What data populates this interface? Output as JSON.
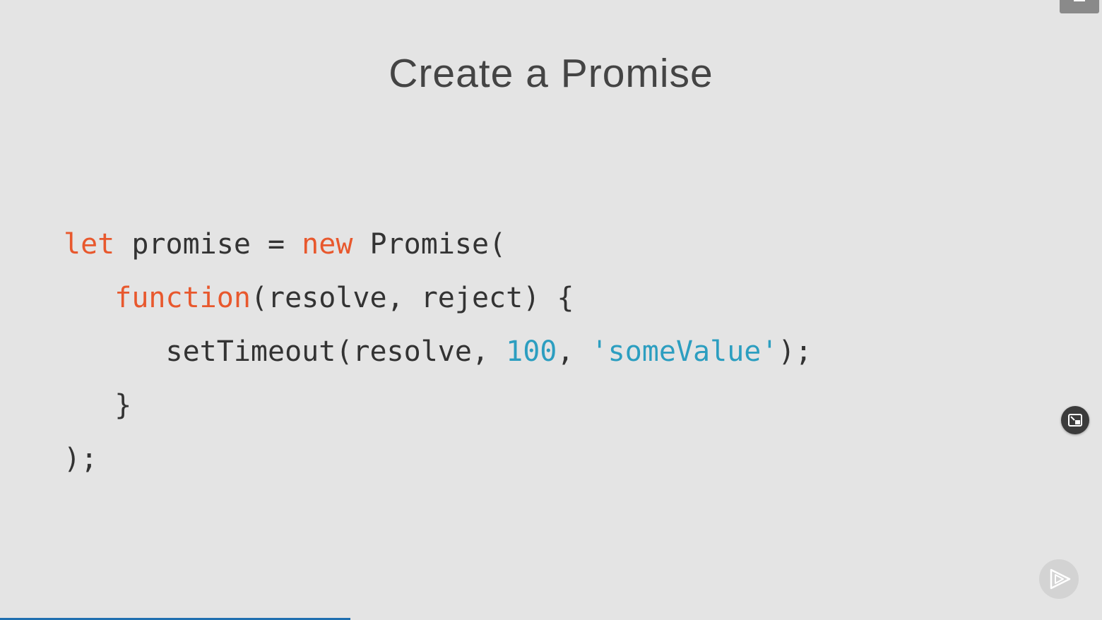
{
  "slide": {
    "title": "Create a Promise"
  },
  "code": {
    "lines": [
      [
        {
          "text": "let",
          "kind": "kw"
        },
        {
          "text": " promise = ",
          "kind": "plain"
        },
        {
          "text": "new",
          "kind": "kw"
        },
        {
          "text": " Promise(",
          "kind": "plain"
        }
      ],
      [
        {
          "text": "   ",
          "kind": "plain"
        },
        {
          "text": "function",
          "kind": "kw"
        },
        {
          "text": "(resolve, reject) {",
          "kind": "plain"
        }
      ],
      [
        {
          "text": "      setTimeout(resolve, ",
          "kind": "plain"
        },
        {
          "text": "100",
          "kind": "num"
        },
        {
          "text": ", ",
          "kind": "plain"
        },
        {
          "text": "'someValue'",
          "kind": "str"
        },
        {
          "text": ");",
          "kind": "plain"
        }
      ],
      [
        {
          "text": "   }",
          "kind": "plain"
        }
      ],
      [
        {
          "text": ");",
          "kind": "plain"
        }
      ]
    ]
  },
  "controls": {
    "menu_icon": "hamburger-menu-icon",
    "pip_icon": "picture-in-picture-exit-icon",
    "next_icon": "next-play-icon"
  },
  "playback": {
    "progress_fraction": 0.318
  },
  "colors": {
    "background": "#e4e4e4",
    "keyword": "#e8582d",
    "literal": "#2c9ec0",
    "text": "#333333",
    "progress": "#1f6fb0"
  }
}
